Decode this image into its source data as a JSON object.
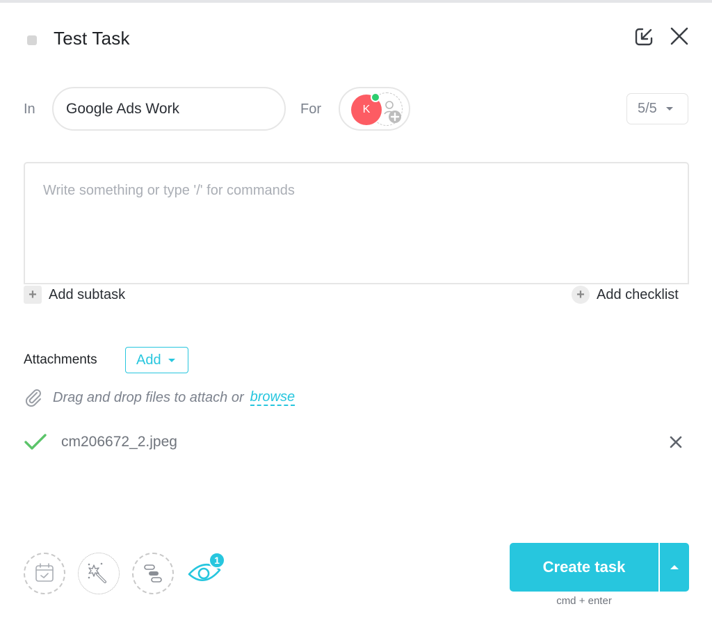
{
  "header": {
    "title": "Test Task",
    "status_icon": "status-square-icon",
    "minimize_icon": "minimize-icon",
    "close_icon": "close-icon"
  },
  "location": {
    "in_label": "In",
    "list_name": "Google Ads Work",
    "for_label": "For",
    "assignee_initial": "K",
    "assignee_color": "#fd5c63",
    "online_color": "#2ecd6f",
    "count_value": "5/5"
  },
  "description": {
    "placeholder": "Write something or type '/' for commands",
    "value": ""
  },
  "actions": {
    "add_subtask": "Add subtask",
    "add_checklist": "Add checklist"
  },
  "attachments": {
    "label": "Attachments",
    "add_label": "Add",
    "dropzone_text": "Drag and drop files to attach or",
    "browse_label": "browse",
    "files": [
      {
        "name": "cm206672_2.jpeg",
        "status": "uploaded"
      }
    ]
  },
  "footer": {
    "tools": [
      "calendar-check-icon",
      "magic-wand-icon",
      "gantt-icon"
    ],
    "watchers_count": "1",
    "create_label": "Create task",
    "shortcut": "cmd + enter",
    "accent_color": "#27c6de"
  }
}
